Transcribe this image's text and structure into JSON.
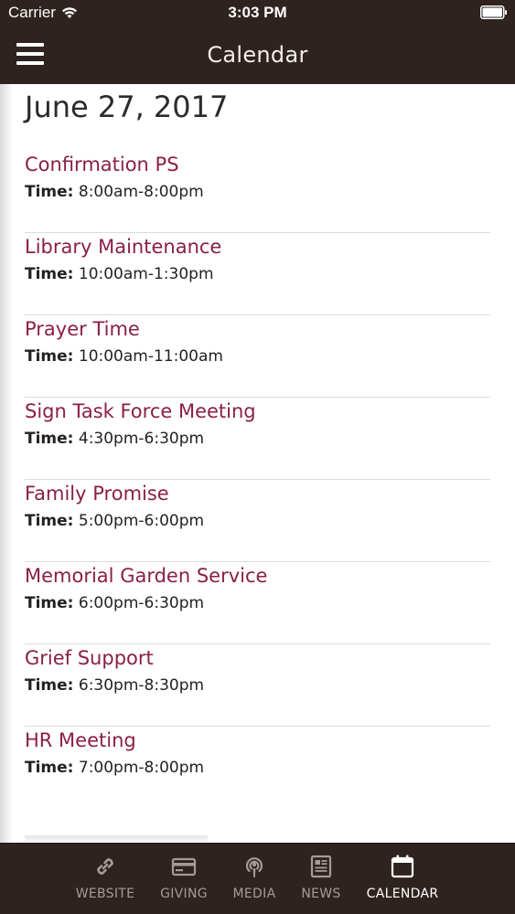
{
  "status_bar": {
    "carrier": "Carrier",
    "time": "3:03 PM"
  },
  "nav": {
    "title": "Calendar",
    "menu_icon": "hamburger-menu-icon"
  },
  "date_heading": "June 27, 2017",
  "time_label": "Time:",
  "events": [
    {
      "title": "Confirmation PS",
      "time": "8:00am-8:00pm"
    },
    {
      "title": "Library Maintenance",
      "time": "10:00am-1:30pm"
    },
    {
      "title": "Prayer Time",
      "time": "10:00am-11:00am"
    },
    {
      "title": "Sign Task Force Meeting",
      "time": "4:30pm-6:30pm"
    },
    {
      "title": "Family Promise",
      "time": "5:00pm-6:00pm"
    },
    {
      "title": "Memorial Garden Service",
      "time": "6:00pm-6:30pm"
    },
    {
      "title": "Grief Support",
      "time": "6:30pm-8:30pm"
    },
    {
      "title": "HR Meeting",
      "time": "7:00pm-8:00pm"
    }
  ],
  "tabs": [
    {
      "label": "WEBSITE",
      "icon": "link-icon",
      "active": false
    },
    {
      "label": "GIVING",
      "icon": "credit-card-icon",
      "active": false
    },
    {
      "label": "MEDIA",
      "icon": "podcast-icon",
      "active": false
    },
    {
      "label": "NEWS",
      "icon": "newspaper-icon",
      "active": false
    },
    {
      "label": "CALENDAR",
      "icon": "calendar-icon",
      "active": true
    }
  ],
  "colors": {
    "bar_background": "#2f231f",
    "event_title": "#8a1f48",
    "tab_inactive": "#a59c97",
    "tab_active": "#ffffff"
  }
}
